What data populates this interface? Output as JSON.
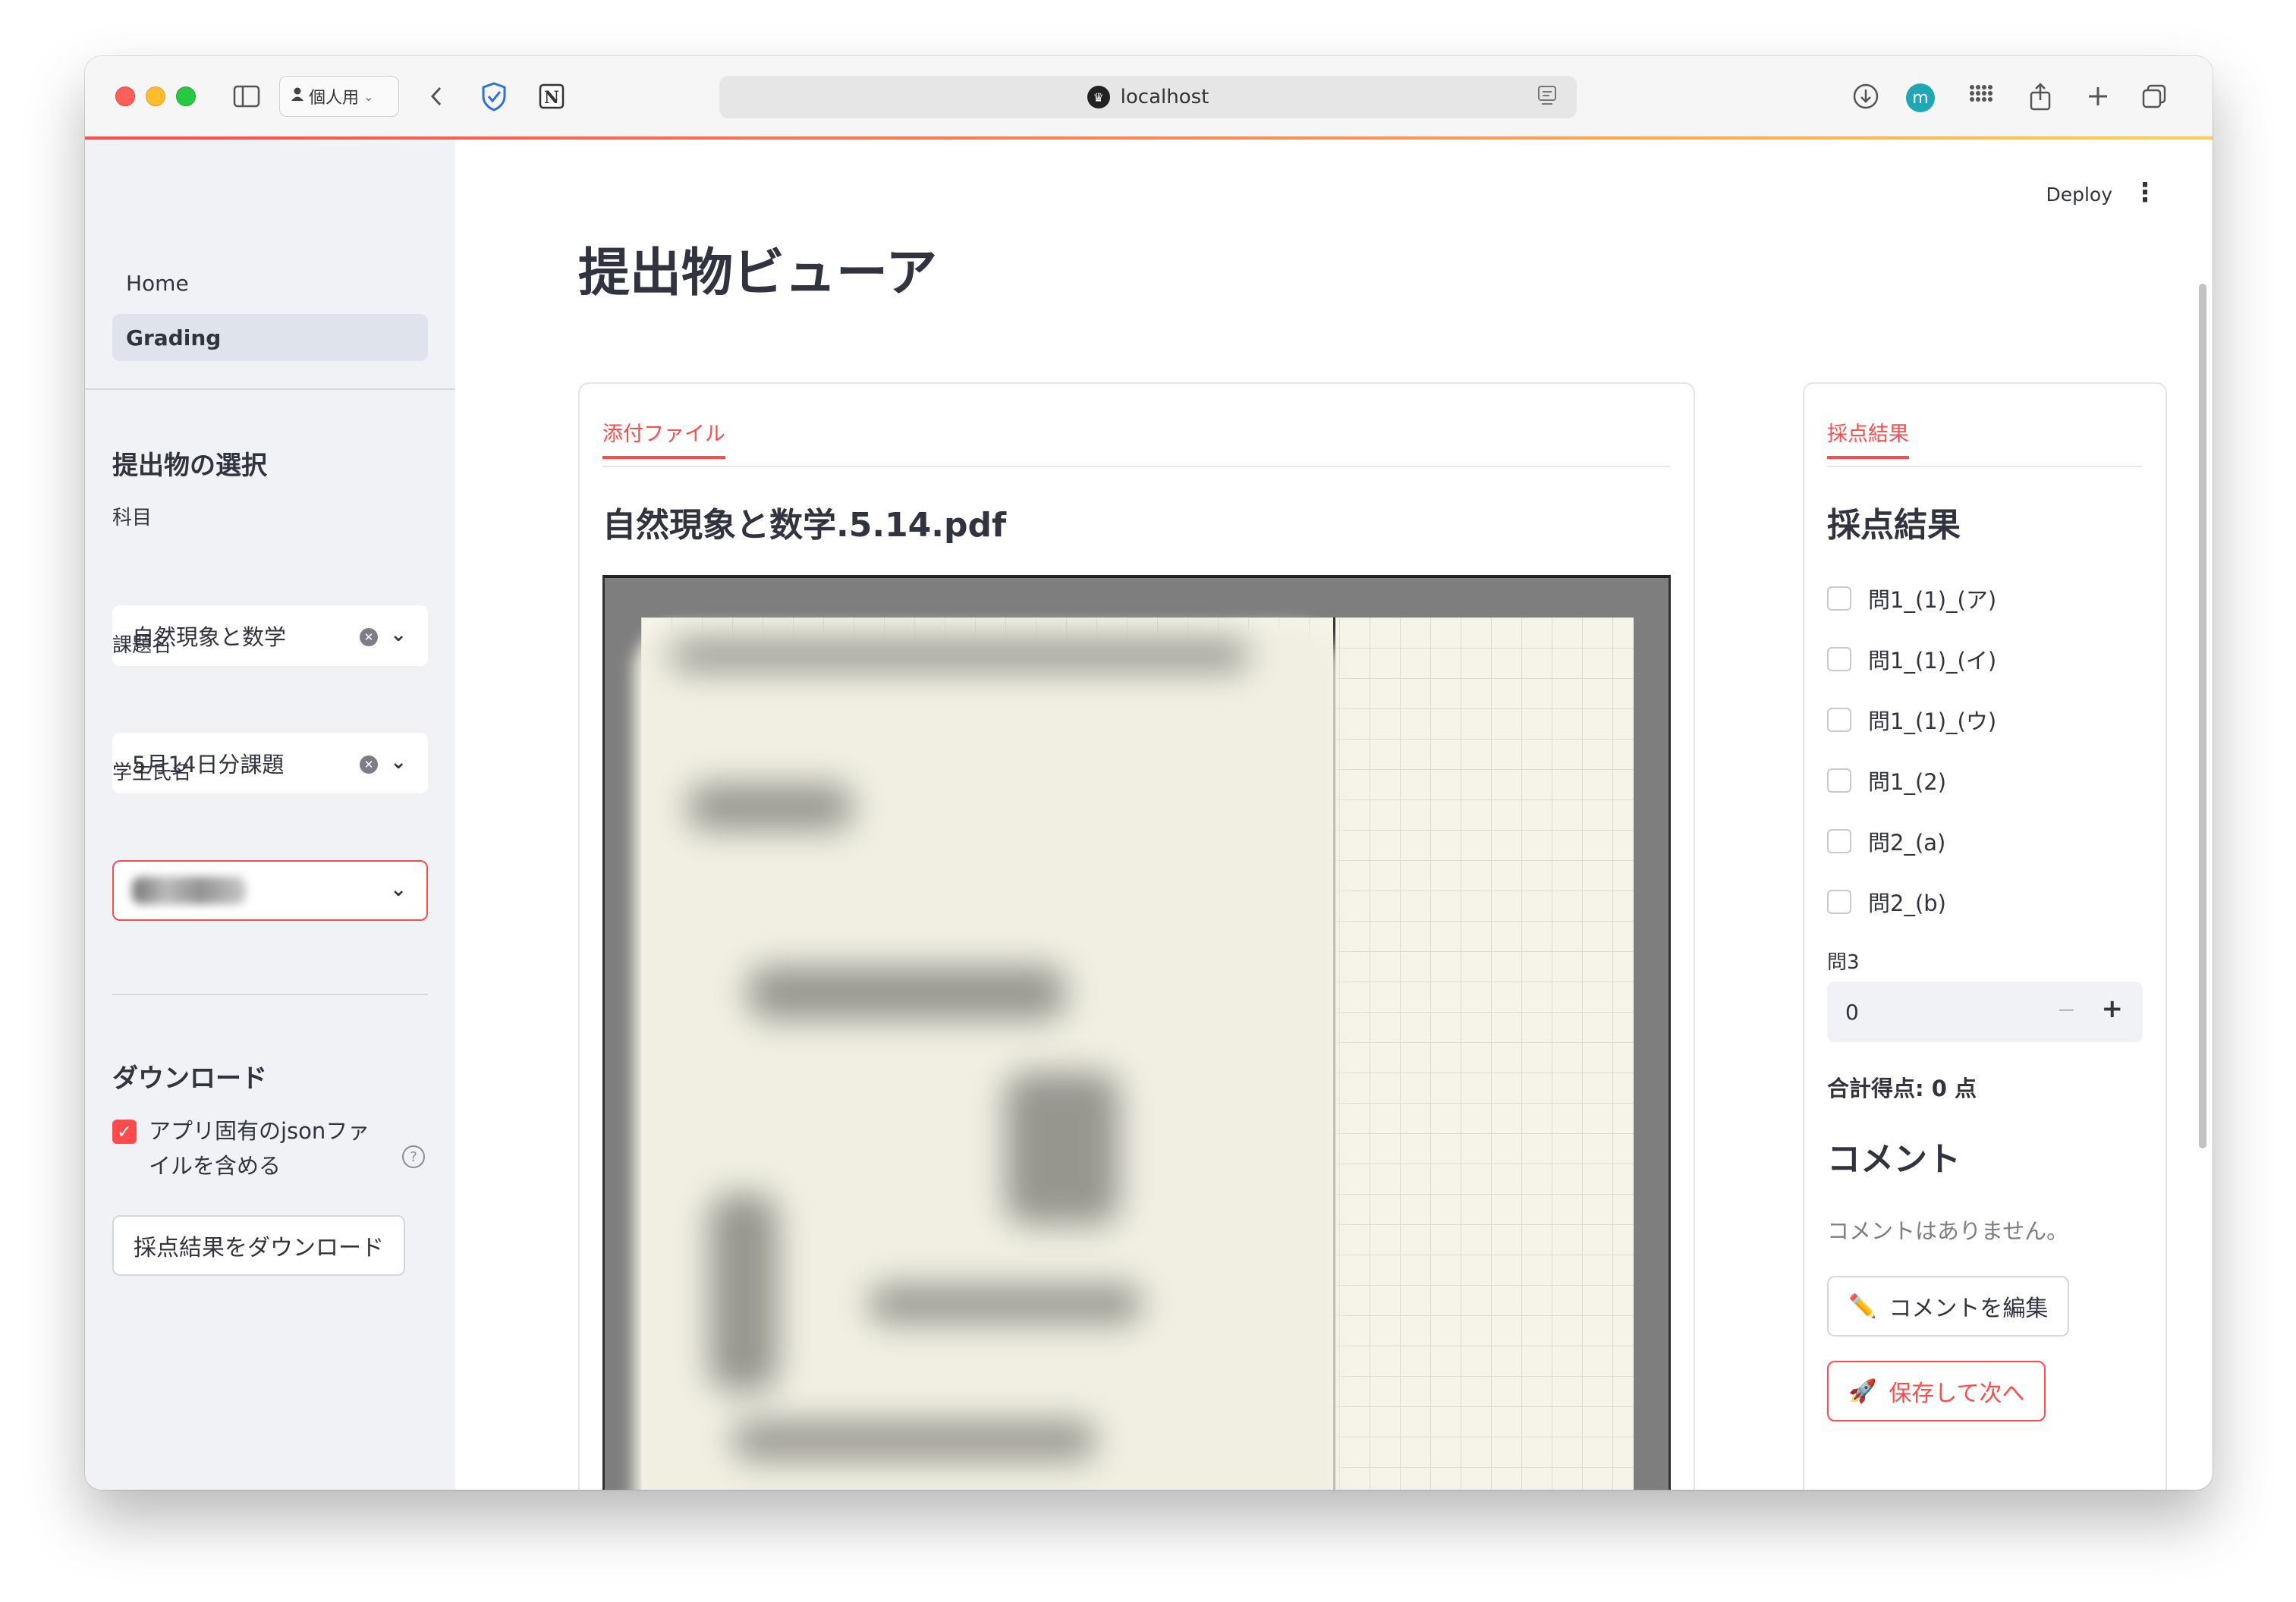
{
  "browser": {
    "profile_label": "個人用",
    "url": "localhost"
  },
  "header": {
    "deploy_label": "Deploy"
  },
  "sidebar": {
    "nav": [
      {
        "label": "Home"
      },
      {
        "label": "Grading",
        "active": true
      }
    ],
    "selection": {
      "heading": "提出物の選択",
      "subject_label": "科目",
      "subject_value": "自然現象と数学",
      "assignment_label": "課題名",
      "assignment_value": "5月14日分課題",
      "student_label": "学生氏名"
    },
    "download": {
      "heading": "ダウンロード",
      "include_json_label": "アプリ固有のjsonファイルを含める",
      "include_json_checked": true,
      "download_button": "採点結果をダウンロード"
    }
  },
  "main": {
    "title": "提出物ビューア",
    "attachment_card": {
      "tab_label": "添付ファイル",
      "file_name": "自然現象と数学.5.14.pdf"
    },
    "grading_card": {
      "tab_label": "採点結果",
      "heading": "採点結果",
      "items": [
        {
          "label": "問1_(1)_(ア)",
          "checked": false
        },
        {
          "label": "問1_(1)_(イ)",
          "checked": false
        },
        {
          "label": "問1_(1)_(ウ)",
          "checked": false
        },
        {
          "label": "問1_(2)",
          "checked": false
        },
        {
          "label": "問2_(a)",
          "checked": false
        },
        {
          "label": "問2_(b)",
          "checked": false
        }
      ],
      "q3_label": "問3",
      "q3_value": "0",
      "total_label": "合計得点: 0 点",
      "comment_heading": "コメント",
      "no_comment_text": "コメントはありません。",
      "edit_comment_button": "コメントを編集",
      "save_next_button": "保存して次へ"
    }
  },
  "colors": {
    "accent": "#ff4b4b",
    "sidebar_bg": "#f0f2f6"
  }
}
